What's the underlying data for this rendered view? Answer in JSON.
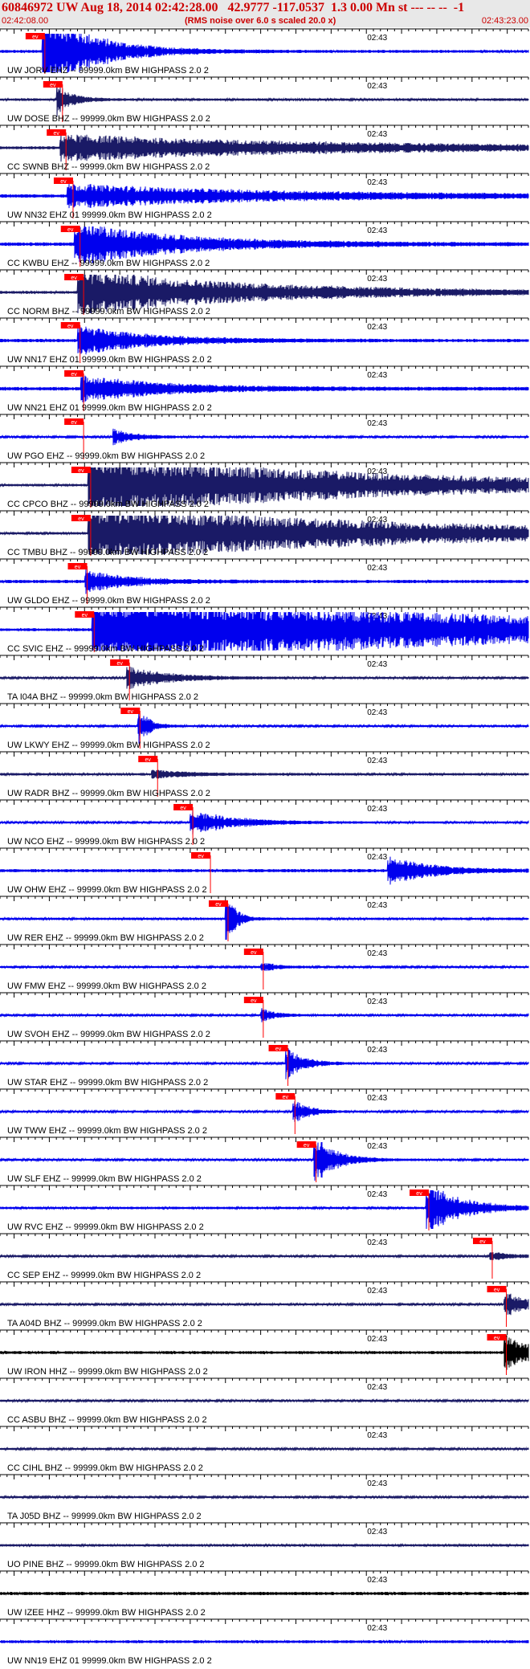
{
  "header": {
    "title": "60846972 UW Aug 18, 2014 02:42:28.00   42.9777 -117.0537  1.3 0.00 Mn st --- -- --  -1",
    "time_start": "02:42:08.00",
    "rms_note": "(RMS noise over 6.0 s scaled 20.0 x)",
    "time_end": "02:43:23.00"
  },
  "colors": {
    "header_bg": "#e8e8e8",
    "header_text": "#cc0000",
    "trace_blue": "#0000ee",
    "trace_navy": "#1a1a66",
    "trace_black": "#000000",
    "pick_red": "#ff0000",
    "label": "#000000"
  },
  "chart_data": {
    "type": "line",
    "x_range": [
      "02:42:08.00",
      "02:43:23.00"
    ],
    "tick_label": "02:43",
    "pick_label": "ev",
    "traces": [
      {
        "label": "UW JORV EHZ -- 99999.0km BW  HIGHPASS  2.0  2",
        "color": "blue",
        "pick_time": "02:42:13.0",
        "amplitude": 0.4,
        "quake": {
          "start": "02:42:14.0",
          "amp": 3.0,
          "decay": 7.0
        }
      },
      {
        "label": "UW DOSE BHZ -- 99999.0km BW  HIGHPASS  2.0  2",
        "color": "navy",
        "pick_time": "02:42:15.5",
        "amplitude": 0.35,
        "quake": {
          "start": "02:42:16.0",
          "amp": 1.2,
          "decay": 2.0
        }
      },
      {
        "label": "CC SWNB BHZ -- 99999.0km BW  HIGHPASS  2.0  2",
        "color": "navy",
        "pick_time": "02:42:16.0",
        "amplitude": 0.4,
        "quake": {
          "start": "02:42:16.5",
          "amp": 0.9,
          "decay": 40.0
        }
      },
      {
        "label": "UW NN32 EHZ 01 99999.0km BW  HIGHPASS  2.0  2",
        "color": "blue",
        "pick_time": "02:42:17.0",
        "amplitude": 0.5,
        "quake": {
          "start": "02:42:17.5",
          "amp": 0.8,
          "decay": 30.0
        }
      },
      {
        "label": "CC KWBU EHZ -- 99999.0km BW  HIGHPASS  2.0  2",
        "color": "blue",
        "pick_time": "02:42:18.0",
        "amplitude": 0.5,
        "quake": {
          "start": "02:42:18.5",
          "amp": 1.5,
          "decay": 15.0
        }
      },
      {
        "label": "CC NORM BHZ -- 99999.0km BW  HIGHPASS  2.0  2",
        "color": "navy",
        "pick_time": "02:42:18.5",
        "amplitude": 0.4,
        "quake": {
          "start": "02:42:19.0",
          "amp": 1.6,
          "decay": 25.0
        }
      },
      {
        "label": "UW NN17 EHZ 01 99999.0km BW  HIGHPASS  2.0  2",
        "color": "blue",
        "pick_time": "02:42:18.0",
        "amplitude": 0.45,
        "quake": {
          "start": "02:42:19.0",
          "amp": 1.0,
          "decay": 10.0
        }
      },
      {
        "label": "UW NN21 EHZ 01 99999.0km BW  HIGHPASS  2.0  2",
        "color": "blue",
        "pick_time": "02:42:18.5",
        "amplitude": 0.5,
        "quake": {
          "start": "02:42:19.5",
          "amp": 0.9,
          "decay": 12.0
        }
      },
      {
        "label": "UW PGO EHZ -- 99999.0km BW  HIGHPASS  2.0  2",
        "color": "blue",
        "pick_time": "02:42:18.5",
        "amplitude": 0.3,
        "quake": {
          "start": "02:42:24.0",
          "amp": 0.6,
          "decay": 3.0
        }
      },
      {
        "label": "CC CPCO BHZ -- 99999.0km BW  HIGHPASS  2.0  2",
        "color": "navy",
        "pick_time": "02:42:19.5",
        "amplitude": 0.35,
        "quake": {
          "start": "02:42:20.5",
          "amp": 2.2,
          "decay": 40.0
        }
      },
      {
        "label": "CC TMBU BHZ -- 99999.0km BW  HIGHPASS  2.0  2",
        "color": "navy",
        "pick_time": "02:42:19.5",
        "amplitude": 0.35,
        "quake": {
          "start": "02:42:20.5",
          "amp": 2.0,
          "decay": 45.0
        }
      },
      {
        "label": "UW GLDO EHZ -- 99999.0km BW  HIGHPASS  2.0  2",
        "color": "blue",
        "pick_time": "02:42:19.0",
        "amplitude": 0.45,
        "quake": {
          "start": "02:42:20.0",
          "amp": 0.8,
          "decay": 6.0
        }
      },
      {
        "label": "CC SVIC EHZ -- 99999.0km BW  HIGHPASS  2.0  2",
        "color": "blue",
        "pick_time": "02:42:20.0",
        "amplitude": 0.4,
        "quake": {
          "start": "02:42:21.0",
          "amp": 2.5,
          "decay": 60.0
        }
      },
      {
        "label": "TA I04A BHZ -- 99999.0km BW  HIGHPASS  2.0  2",
        "color": "navy",
        "pick_time": "02:42:25.0",
        "amplitude": 0.3,
        "quake": {
          "start": "02:42:26.0",
          "amp": 0.8,
          "decay": 6.0
        }
      },
      {
        "label": "UW LKWY EHZ -- 99999.0km BW  HIGHPASS  2.0  2",
        "color": "blue",
        "pick_time": "02:42:26.5",
        "amplitude": 0.3,
        "quake": {
          "start": "02:42:27.5",
          "amp": 1.5,
          "decay": 1.5
        }
      },
      {
        "label": "UW RADR BHZ -- 99999.0km BW  HIGHPASS  2.0  2",
        "color": "navy",
        "pick_time": "02:42:29.0",
        "amplitude": 0.35,
        "quake": {
          "start": "02:42:29.5",
          "amp": 0.3,
          "decay": 5.0
        }
      },
      {
        "label": "UW NCO EHZ -- 99999.0km BW  HIGHPASS  2.0  2",
        "color": "blue",
        "pick_time": "02:42:34.0",
        "amplitude": 0.3,
        "quake": {
          "start": "02:42:35.0",
          "amp": 0.9,
          "decay": 6.0
        }
      },
      {
        "label": "UW OHW EHZ -- 99999.0km BW  HIGHPASS  2.0  2",
        "color": "blue",
        "pick_time": "02:42:36.5",
        "amplitude": 0.45,
        "quake": {
          "start": "02:43:03.0",
          "amp": 1.0,
          "decay": 6.0
        }
      },
      {
        "label": "UW RER EHZ -- 99999.0km BW  HIGHPASS  2.0  2",
        "color": "blue",
        "pick_time": "02:42:39.0",
        "amplitude": 0.35,
        "quake": {
          "start": "02:42:40.0",
          "amp": 2.4,
          "decay": 1.2
        }
      },
      {
        "label": "UW FMW EHZ -- 99999.0km BW  HIGHPASS  2.0  2",
        "color": "blue",
        "pick_time": "02:42:44.0",
        "amplitude": 0.3,
        "quake": {
          "start": "02:42:45.0",
          "amp": 0.4,
          "decay": 2.0
        }
      },
      {
        "label": "UW SVOH EHZ -- 99999.0km BW  HIGHPASS  2.0  2",
        "color": "blue",
        "pick_time": "02:42:44.0",
        "amplitude": 0.3,
        "quake": {
          "start": "02:42:45.0",
          "amp": 0.5,
          "decay": 2.0
        }
      },
      {
        "label": "UW STAR EHZ -- 99999.0km BW  HIGHPASS  2.0  2",
        "color": "blue",
        "pick_time": "02:42:47.5",
        "amplitude": 0.3,
        "quake": {
          "start": "02:42:48.5",
          "amp": 1.2,
          "decay": 2.5
        }
      },
      {
        "label": "UW TWW EHZ -- 99999.0km BW  HIGHPASS  2.0  2",
        "color": "blue",
        "pick_time": "02:42:48.5",
        "amplitude": 0.3,
        "quake": {
          "start": "02:42:49.5",
          "amp": 1.0,
          "decay": 2.0
        }
      },
      {
        "label": "UW SLF EHZ -- 99999.0km BW  HIGHPASS  2.0  2",
        "color": "blue",
        "pick_time": "02:42:51.5",
        "amplitude": 0.3,
        "quake": {
          "start": "02:42:52.5",
          "amp": 1.8,
          "decay": 3.0
        }
      },
      {
        "label": "UW RVC EHZ -- 99999.0km BW  HIGHPASS  2.0  2",
        "color": "blue",
        "pick_time": "02:43:07.5",
        "amplitude": 0.35,
        "quake": {
          "start": "02:43:08.5",
          "amp": 1.8,
          "decay": 5.0
        }
      },
      {
        "label": "CC SEP EHZ -- 99999.0km BW  HIGHPASS  2.0  2",
        "color": "navy",
        "pick_time": "02:43:16.5",
        "amplitude": 0.3,
        "quake": {
          "start": "02:43:17.5",
          "amp": 0.3,
          "decay": 3.0
        }
      },
      {
        "label": "TA A04D BHZ -- 99999.0km BW  HIGHPASS  2.0  2",
        "color": "navy",
        "pick_time": "02:43:18.5",
        "amplitude": 0.3,
        "quake": {
          "start": "02:43:19.5",
          "amp": 1.0,
          "decay": 3.0
        }
      },
      {
        "label": "UW IRON HHZ -- 99999.0km BW  HIGHPASS  2.0  2",
        "color": "black",
        "pick_time": "02:43:18.5",
        "amplitude": 0.4,
        "quake": {
          "start": "02:43:19.5",
          "amp": 1.3,
          "decay": 4.0
        }
      },
      {
        "label": "CC ASBU BHZ -- 99999.0km BW  HIGHPASS  2.0  2",
        "color": "navy",
        "pick_time": null,
        "amplitude": 0.3,
        "quake": null
      },
      {
        "label": "CC CIHL BHZ -- 99999.0km BW  HIGHPASS  2.0  2",
        "color": "navy",
        "pick_time": null,
        "amplitude": 0.3,
        "quake": null
      },
      {
        "label": "TA J05D BHZ -- 99999.0km BW  HIGHPASS  2.0  2",
        "color": "navy",
        "pick_time": null,
        "amplitude": 0.3,
        "quake": null
      },
      {
        "label": "UO PINE BHZ -- 99999.0km BW  HIGHPASS  2.0  2",
        "color": "navy",
        "pick_time": null,
        "amplitude": 0.35,
        "quake": null
      },
      {
        "label": "UW IZEE HHZ -- 99999.0km BW  HIGHPASS  2.0  2",
        "color": "black",
        "pick_time": null,
        "amplitude": 0.45,
        "quake": null
      },
      {
        "label": "UW NN19 EHZ 01 99999.0km BW  HIGHPASS  2.0  2",
        "color": "blue",
        "pick_time": null,
        "amplitude": 0.4,
        "quake": null
      }
    ]
  }
}
